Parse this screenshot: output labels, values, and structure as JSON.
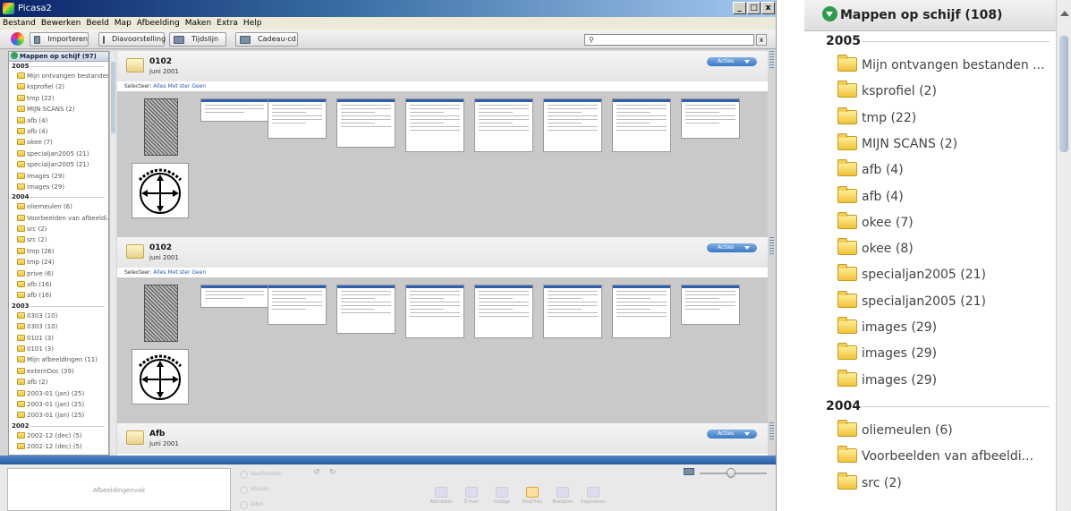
{
  "window": {
    "title": "Picasa2",
    "min": "_",
    "max": "à",
    "close": "x"
  },
  "menu": [
    "Bestand",
    "Bewerken",
    "Beeld",
    "Map",
    "Afbeelding",
    "Maken",
    "Extra",
    "Help"
  ],
  "toolbar": {
    "import": "Importeren",
    "slideshow": "Diavoorstelling",
    "timeline": "Tijdslijn",
    "gift": "Cadeau-cd",
    "search_value": "",
    "clear": "x"
  },
  "sidebar": {
    "header": "Mappen op schijf (97)",
    "groups": [
      {
        "year": "2005",
        "items": [
          "Mijn ontvangen bestanden ...",
          "ksprofiel (2)",
          "tmp (22)",
          "MIJN SCANS (2)",
          "afb (4)",
          "afb (4)",
          "okee (7)",
          "specialjan2005 (21)",
          "specialjan2005 (21)",
          "images (29)",
          "images (29)"
        ]
      },
      {
        "year": "2004",
        "items": [
          "oliemeulen (6)",
          "Voorbeelden van afbeeldi...",
          "src (2)",
          "src (2)",
          "tmp (26)",
          "tmp (24)",
          "prive (6)",
          "afb (16)",
          "afb (16)"
        ]
      },
      {
        "year": "2003",
        "items": [
          "0303 (10)",
          "0303 (10)",
          "0101 (3)",
          "0101 (3)",
          "Mijn afbeeldingen (11)",
          "externDoc (39)",
          "afb (2)",
          "2003-01 (jan) (25)",
          "2003-01 (jan) (25)",
          "2003-01 (jan) (25)"
        ]
      },
      {
        "year": "2002",
        "items": [
          "2002-12 (dec) (5)",
          "2002-12 (dec) (5)"
        ]
      }
    ]
  },
  "content": {
    "actions_label": "Acties",
    "select": {
      "prefix": "Selecteer:",
      "all": "Alles",
      "starred": "Met ster",
      "none": "Geen"
    },
    "sections": [
      {
        "title": "0102",
        "date": "juni 2001"
      },
      {
        "title": "0102",
        "date": "juni 2001"
      },
      {
        "title": "Afb",
        "date": "juni 2001"
      }
    ]
  },
  "bottom": {
    "tray_label": "Afbeeldingenvak",
    "tray_buttons": [
      "Vasthouden",
      "Wissen",
      "label"
    ],
    "rotate_left": "↺",
    "rotate_right": "↻",
    "actions": [
      "Afdrukken",
      "E-mail",
      "Collage",
      "BlogThis!",
      "Bestellen",
      "Exporteren"
    ]
  },
  "zoom": {
    "header": "Mappen op schijf (108)",
    "groups": [
      {
        "year": "2005",
        "items": [
          "Mijn ontvangen bestanden ...",
          "ksprofiel (2)",
          "tmp (22)",
          "MIJN SCANS (2)",
          "afb (4)",
          "afb (4)",
          "okee (7)",
          "okee (8)",
          "specialjan2005 (21)",
          "specialjan2005 (21)",
          "images (29)",
          "images (29)",
          "images (29)"
        ]
      },
      {
        "year": "2004",
        "items": [
          "oliemeulen (6)",
          "Voorbeelden van afbeeldi...",
          "src (2)"
        ]
      }
    ]
  },
  "colors": {
    "accent": "#2f5fb1",
    "separator": "#3a6db5",
    "folder": "#f0c23a",
    "toggle": "#2e9a4a"
  }
}
